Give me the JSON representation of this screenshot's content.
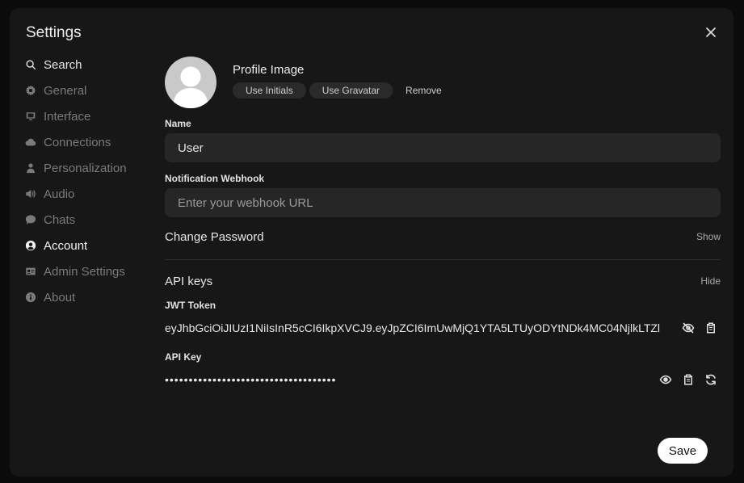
{
  "dialog": {
    "title": "Settings",
    "close_icon": "close-icon"
  },
  "sidebar": {
    "items": [
      {
        "label": "Search",
        "icon": "search-icon"
      },
      {
        "label": "General",
        "icon": "gear-icon"
      },
      {
        "label": "Interface",
        "icon": "monitor-icon"
      },
      {
        "label": "Connections",
        "icon": "cloud-icon"
      },
      {
        "label": "Personalization",
        "icon": "person-icon"
      },
      {
        "label": "Audio",
        "icon": "speaker-icon"
      },
      {
        "label": "Chats",
        "icon": "chat-bubble-icon"
      },
      {
        "label": "Account",
        "icon": "user-circle-icon"
      },
      {
        "label": "Admin Settings",
        "icon": "id-card-icon"
      },
      {
        "label": "About",
        "icon": "info-icon"
      }
    ],
    "active": "Account"
  },
  "profile": {
    "label": "Profile Image",
    "use_initials": "Use Initials",
    "use_gravatar": "Use Gravatar",
    "remove": "Remove"
  },
  "name": {
    "label": "Name",
    "value": "User"
  },
  "webhook": {
    "label": "Notification Webhook",
    "value": "",
    "placeholder": "Enter your webhook URL"
  },
  "password": {
    "label": "Change Password",
    "action": "Show"
  },
  "api": {
    "title": "API keys",
    "action": "Hide",
    "jwt_label": "JWT Token",
    "jwt_value": "eyJhbGciOiJIUzI1NiIsInR5cCI6IkpXVCJ9.eyJpZCI6ImUwMjQ1YTA5LTUyODYtNDk4MC04NjlkLTZl",
    "key_label": "API Key",
    "key_value": "••••••••••••••••••••••••••••••••••••"
  },
  "footer": {
    "save_label": "Save"
  },
  "colors": {
    "background": "#171717",
    "field": "#262626",
    "accent": "#ffffff"
  }
}
